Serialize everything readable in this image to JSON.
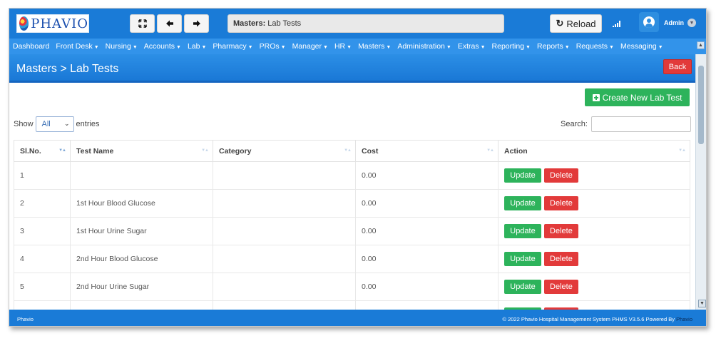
{
  "app": {
    "logo_text": "PHAVIO"
  },
  "toolbar": {
    "breadcrumb_bold": "Masters:",
    "breadcrumb_text": "Lab Tests",
    "reload_label": "Reload"
  },
  "user": {
    "name": "Admin"
  },
  "nav": {
    "items": [
      {
        "label": "Dashboard",
        "dropdown": false
      },
      {
        "label": "Front Desk",
        "dropdown": true
      },
      {
        "label": "Nursing",
        "dropdown": true
      },
      {
        "label": "Accounts",
        "dropdown": true
      },
      {
        "label": "Lab",
        "dropdown": true
      },
      {
        "label": "Pharmacy",
        "dropdown": true
      },
      {
        "label": "PROs",
        "dropdown": true
      },
      {
        "label": "Manager",
        "dropdown": true
      },
      {
        "label": "HR",
        "dropdown": true
      },
      {
        "label": "Masters",
        "dropdown": true
      },
      {
        "label": "Administration",
        "dropdown": true
      },
      {
        "label": "Extras",
        "dropdown": true
      },
      {
        "label": "Reporting",
        "dropdown": true
      },
      {
        "label": "Reports",
        "dropdown": true
      },
      {
        "label": "Requests",
        "dropdown": true
      },
      {
        "label": "Messaging",
        "dropdown": true
      }
    ]
  },
  "page": {
    "title": "Masters > Lab Tests",
    "back_label": "Back",
    "create_label": "Create New Lab Test"
  },
  "list_controls": {
    "show_label": "Show",
    "page_size": "All",
    "entries_label": "entries",
    "search_label": "Search:",
    "search_value": ""
  },
  "table": {
    "columns": [
      "Sl.No.",
      "Test Name",
      "Category",
      "Cost",
      "Action"
    ],
    "rows": [
      {
        "sl": "1",
        "name": "",
        "category": "",
        "cost": "0.00"
      },
      {
        "sl": "2",
        "name": "1st Hour Blood Glucose",
        "category": "",
        "cost": "0.00"
      },
      {
        "sl": "3",
        "name": "1st Hour Urine Sugar",
        "category": "",
        "cost": "0.00"
      },
      {
        "sl": "4",
        "name": "2nd Hour Blood Glucose",
        "category": "",
        "cost": "0.00"
      },
      {
        "sl": "5",
        "name": "2nd Hour Urine Sugar",
        "category": "",
        "cost": "0.00"
      },
      {
        "sl": "",
        "name": "",
        "category": "",
        "cost": ""
      }
    ],
    "update_label": "Update",
    "delete_label": "Delete"
  },
  "footer": {
    "left": "Phavio",
    "right": "© 2022 Phavio Hospital Management System PHMS V3.5.6 Powered By",
    "right_brand": "Phavio"
  },
  "colors": {
    "primary": "#1a7bd7",
    "success": "#2db35b",
    "danger": "#e23a3a"
  }
}
